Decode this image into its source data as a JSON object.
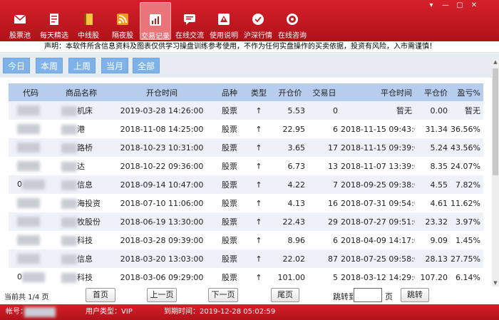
{
  "toolbar": {
    "items": [
      {
        "label": "股票池",
        "icon": "mail-icon"
      },
      {
        "label": "每天精选",
        "icon": "document-icon"
      },
      {
        "label": "中线股",
        "icon": "book-icon"
      },
      {
        "label": "隔夜股",
        "icon": "rss-icon"
      },
      {
        "label": "交易记录",
        "icon": "chart-icon"
      },
      {
        "label": "在线交流",
        "icon": "chat-icon"
      },
      {
        "label": "使用说明",
        "icon": "help-icon"
      },
      {
        "label": "沪深行情",
        "icon": "clock-icon"
      },
      {
        "label": "在线咨询",
        "icon": "support-icon"
      }
    ],
    "active_index": 4
  },
  "disclaimer": "声明：本软件所含信息资料及图表仅供学习操盘训练参考使用，不作为任何实盘操作的买卖依据，投资有风险，入市需谨慎！",
  "filters": [
    "今日",
    "本周",
    "上周",
    "当月",
    "全部"
  ],
  "table": {
    "headers": [
      "代码",
      "商品名称",
      "开仓时间",
      "品种",
      "类型",
      "开仓价",
      "交易日",
      "平仓时间",
      "平仓价",
      "盈亏%"
    ],
    "rows": [
      {
        "code": "",
        "name": "机床",
        "open_time": "2019-03-28 14:26:00",
        "kind": "股票",
        "type": "↑",
        "open_price": "5.53",
        "days": "0",
        "close_time": "暂无",
        "close_price": "0.00",
        "pnl": "暂无"
      },
      {
        "code": "",
        "name": "港",
        "open_time": "2018-11-08 14:25:00",
        "kind": "股票",
        "type": "↑",
        "open_price": "22.95",
        "days": "6",
        "close_time": "2018-11-15 09:43:00",
        "close_price": "31.34",
        "pnl": "36.56%"
      },
      {
        "code": "",
        "name": "路桥",
        "open_time": "2018-10-23 10:31:00",
        "kind": "股票",
        "type": "↑",
        "open_price": "3.65",
        "days": "17",
        "close_time": "2018-11-15 09:39:00",
        "close_price": "5.24",
        "pnl": "43.56%"
      },
      {
        "code": "",
        "name": "达",
        "open_time": "2018-10-22 09:36:00",
        "kind": "股票",
        "type": "↑",
        "open_price": "6.73",
        "days": "13",
        "close_time": "2018-11-07 13:39:00",
        "close_price": "8.35",
        "pnl": "24.07%"
      },
      {
        "code": "0",
        "name": "信息",
        "open_time": "2018-09-14 10:47:00",
        "kind": "股票",
        "type": "↑",
        "open_price": "4.22",
        "days": "7",
        "close_time": "2018-09-25 09:38:00",
        "close_price": "4.55",
        "pnl": "7.82%"
      },
      {
        "code": "",
        "name": "海投资",
        "open_time": "2018-07-10 11:06:00",
        "kind": "股票",
        "type": "↑",
        "open_price": "4.13",
        "days": "16",
        "close_time": "2018-07-31 09:54:00",
        "close_price": "4.61",
        "pnl": "11.62%"
      },
      {
        "code": "",
        "name": "牧股份",
        "open_time": "2018-06-19 13:30:00",
        "kind": "股票",
        "type": "↑",
        "open_price": "22.43",
        "days": "29",
        "close_time": "2018-07-27 09:51:00",
        "close_price": "23.32",
        "pnl": "3.97%"
      },
      {
        "code": "",
        "name": "科技",
        "open_time": "2018-03-28 09:39:00",
        "kind": "股票",
        "type": "↑",
        "open_price": "8.96",
        "days": "6",
        "close_time": "2018-04-09 14:17:00",
        "close_price": "9.09",
        "pnl": "1.45%"
      },
      {
        "code": "",
        "name": "信息",
        "open_time": "2018-03-20 13:03:00",
        "kind": "股票",
        "type": "↑",
        "open_price": "22.02",
        "days": "87",
        "close_time": "2018-07-25 09:58:00",
        "close_price": "28.13",
        "pnl": "27.75%"
      },
      {
        "code": "0",
        "name": "科技",
        "open_time": "2018-03-06 09:29:00",
        "kind": "股票",
        "type": "↑",
        "open_price": "101.00",
        "days": "5",
        "close_time": "2018-03-12 14:29:00",
        "close_price": "107.20",
        "pnl": "6.14%"
      }
    ]
  },
  "pager": {
    "info": "当前共 1/4 页",
    "first": "首页",
    "prev": "上一页",
    "next": "下一页",
    "last": "尾页",
    "jump_label": "跳转到",
    "jump_value": "",
    "jump_unit": "页",
    "jump_button": "跳转"
  },
  "status": {
    "account_label": "帐号：",
    "user_type": "用户类型：VIP",
    "expire": "到期时间：2019-12-28 05:02:59"
  }
}
